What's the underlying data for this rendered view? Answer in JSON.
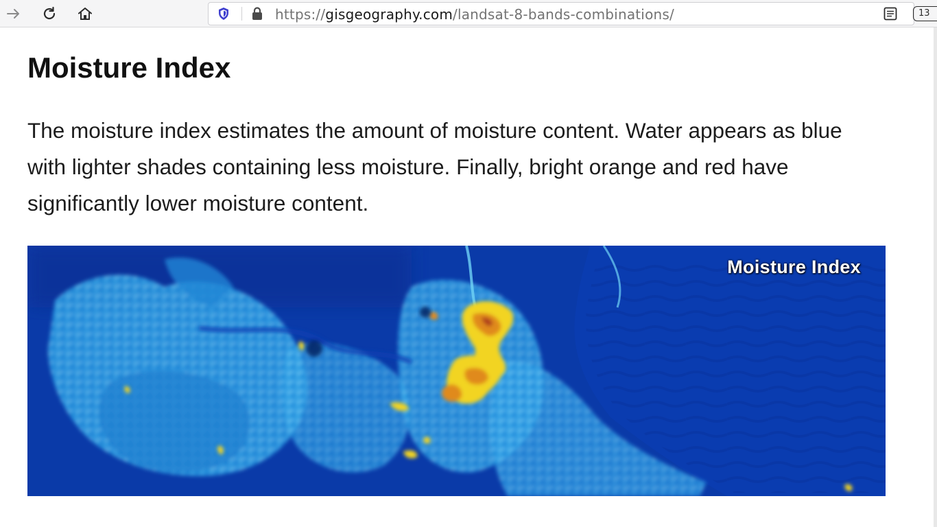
{
  "browser": {
    "url_scheme": "https://",
    "url_host": "gisgeography.com",
    "url_path": "/landsat-8-bands-combinations/",
    "tab_count": "13",
    "icons": [
      "forward-arrow-icon",
      "reload-icon",
      "home-icon",
      "tracking-shield-icon",
      "lock-icon",
      "reader-view-icon"
    ]
  },
  "article": {
    "heading": "Moisture Index",
    "paragraph": "The moisture index estimates the amount of moisture content. Water appears as blue with lighter shades containing less moisture. Finally, bright orange and red have significantly lower moisture content.",
    "figure": {
      "label": "Moisture Index",
      "colors": {
        "deep_water": "#0a3aa8",
        "dark_water": "#072a80",
        "light_moisture": "#2fa8ea",
        "pale_moisture": "#6fd2f5",
        "dry_yellow": "#f2d421",
        "dry_orange": "#e08a1c",
        "dry_red": "#b0401a"
      }
    }
  }
}
